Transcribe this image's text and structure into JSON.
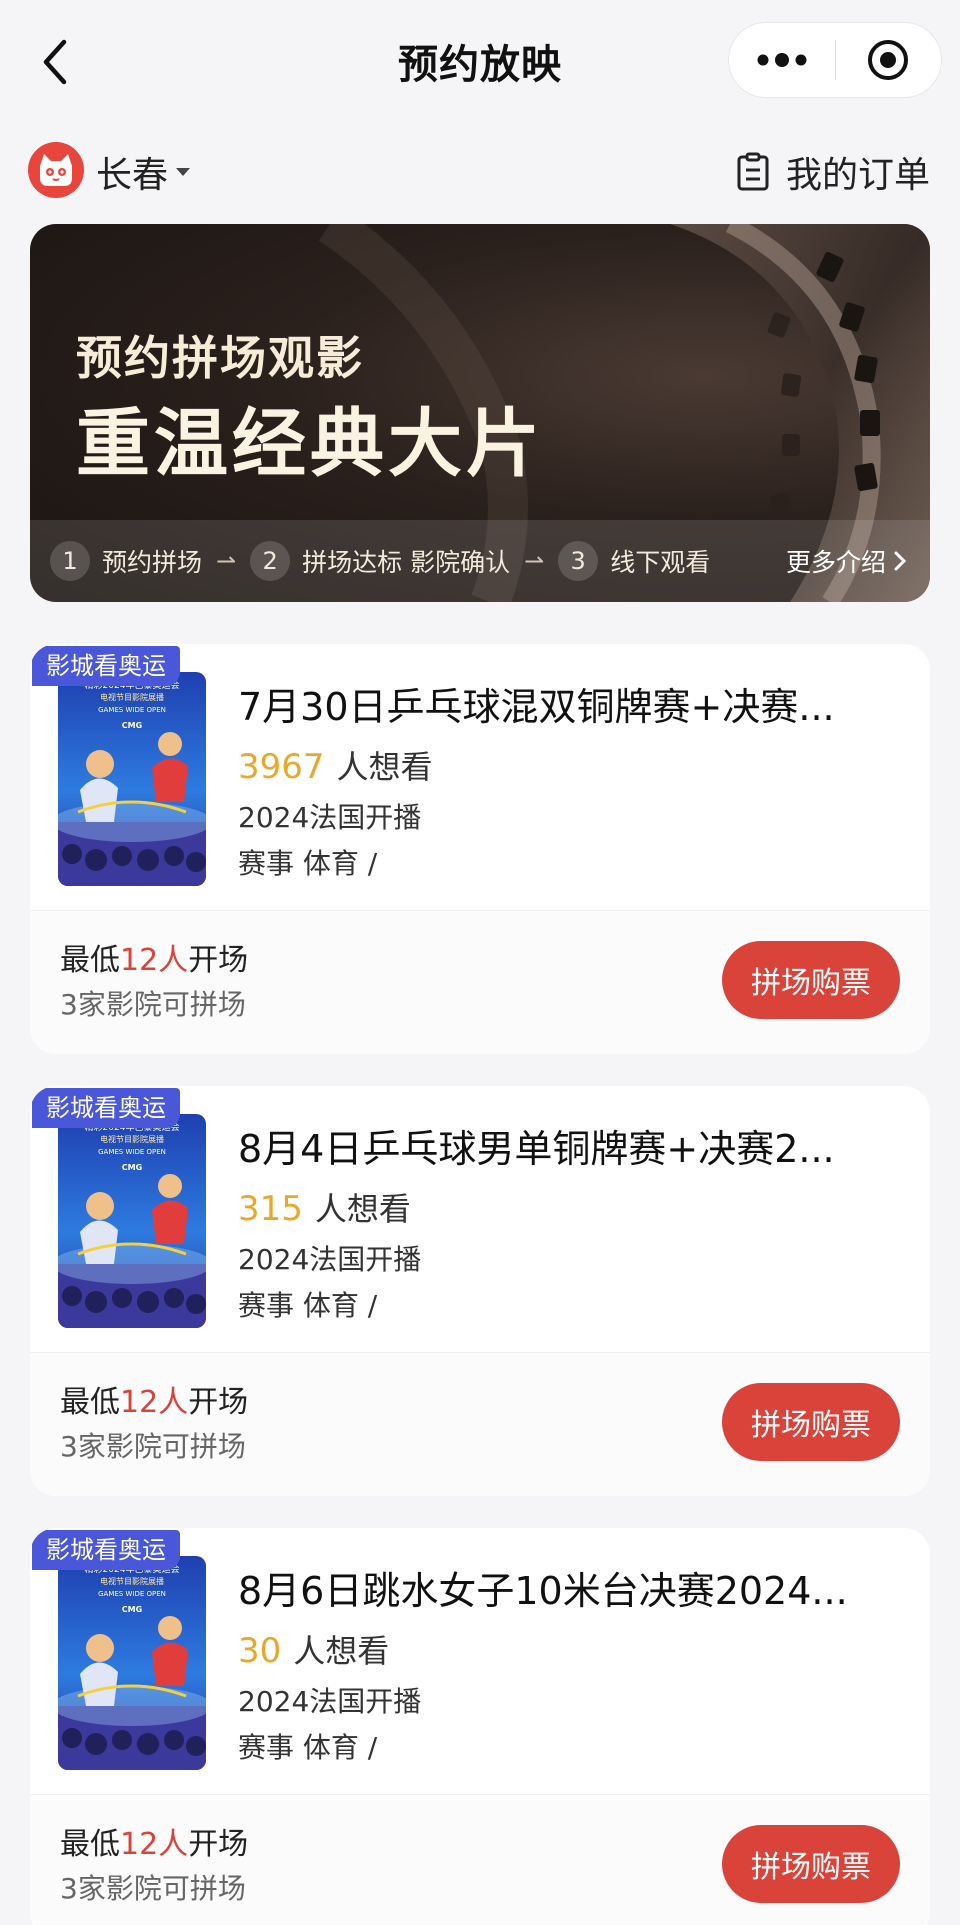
{
  "header": {
    "title": "预约放映"
  },
  "topbar": {
    "city": "长春",
    "orders_label": "我的订单"
  },
  "banner": {
    "subtitle": "预约拼场观影",
    "title": "重温经典大片",
    "steps": [
      {
        "num": "1",
        "label": "预约拼场"
      },
      {
        "num": "2",
        "label": "拼场达标 影院确认"
      },
      {
        "num": "3",
        "label": "线下观看"
      }
    ],
    "step_arrow": "⇀",
    "more_label": "更多介绍"
  },
  "events": [
    {
      "tag": "影城看奥运",
      "title": "7月30日乒乓球混双铜牌赛+决赛...",
      "want_count": "3967",
      "want_label": "人想看",
      "release": "2024法国开播",
      "genre": "赛事 体育 /",
      "min_prefix": "最低",
      "min_count": "12人",
      "min_suffix": "开场",
      "cinemas": "3家影院可拼场",
      "button": "拼场购票"
    },
    {
      "tag": "影城看奥运",
      "title": "8月4日乒乓球男单铜牌赛+决赛2...",
      "want_count": "315",
      "want_label": "人想看",
      "release": "2024法国开播",
      "genre": "赛事 体育 /",
      "min_prefix": "最低",
      "min_count": "12人",
      "min_suffix": "开场",
      "cinemas": "3家影院可拼场",
      "button": "拼场购票"
    },
    {
      "tag": "影城看奥运",
      "title": "8月6日跳水女子10米台决赛2024...",
      "want_count": "30",
      "want_label": "人想看",
      "release": "2024法国开播",
      "genre": "赛事 体育 /",
      "min_prefix": "最低",
      "min_count": "12人",
      "min_suffix": "开场",
      "cinemas": "3家影院可拼场",
      "button": "拼场购票"
    }
  ],
  "poster": {
    "top_line": "精彩2024年巴黎奥运会",
    "second_line": "电视节目影院展播",
    "tagline": "GAMES WIDE OPEN",
    "logo": "CMG"
  },
  "icons": {
    "back": "chevron-left-icon",
    "more": "more-dots-icon",
    "target": "target-icon",
    "logo": "cat-logo-icon",
    "orders": "list-document-icon"
  },
  "colors": {
    "accent_red": "#d9433a",
    "want_count": "#e8a92b",
    "tag_blue": "#4a57d8"
  }
}
